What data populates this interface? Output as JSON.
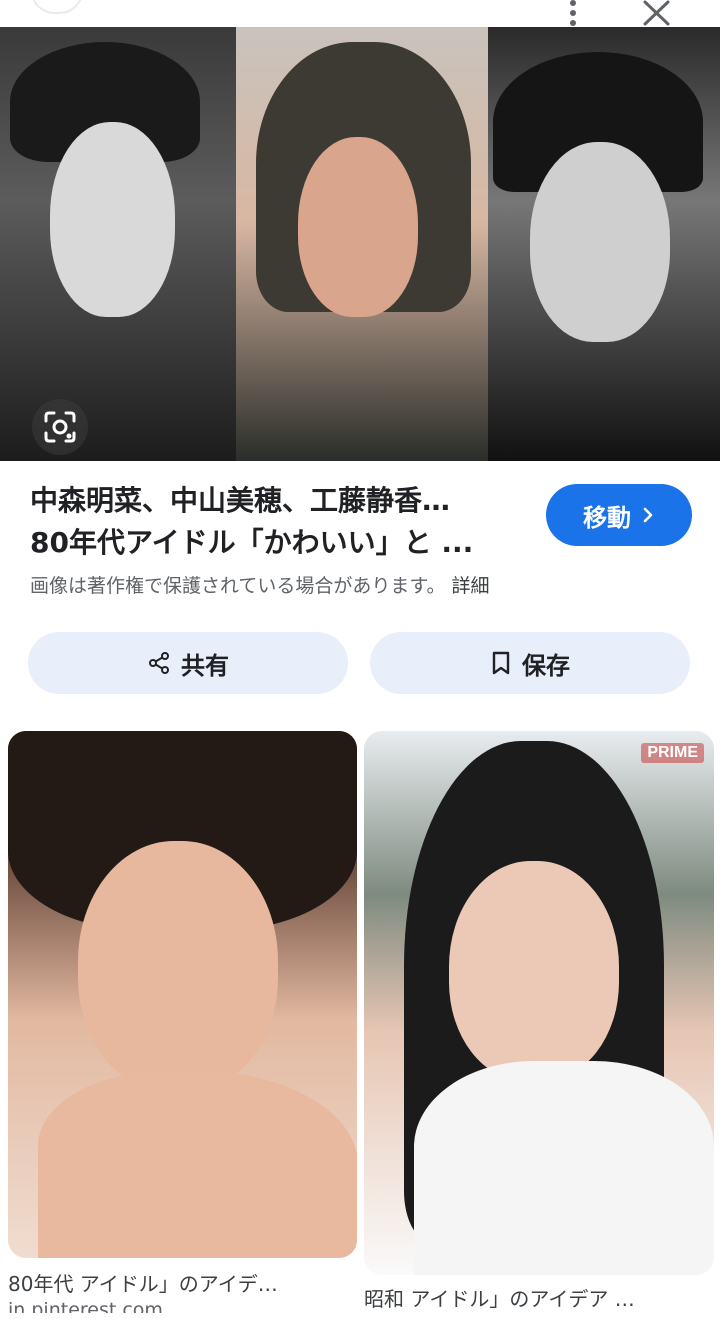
{
  "topbar": {
    "more_icon": "more-vert-icon",
    "close_icon": "close-icon"
  },
  "main_image": {
    "lens_icon": "lens-icon"
  },
  "result": {
    "title_line1": "中森明菜、中山美穂、工藤静香…",
    "title_line2": "80年代アイドル「かわいい」と ...",
    "visit_label": "移動",
    "copyright_note": "画像は著作権で保護されている場合があります。",
    "details_link": "詳細"
  },
  "actions": {
    "share_label": "共有",
    "save_label": "保存"
  },
  "related": [
    {
      "caption": "80年代 アイドル」のアイデ…",
      "source": "in.pinterest.com"
    },
    {
      "caption": "昭和 アイドル」のアイデア …",
      "watermark": "PRIME"
    }
  ],
  "colors": {
    "accent": "#1a73e8",
    "action_bg": "#e8eefa"
  }
}
